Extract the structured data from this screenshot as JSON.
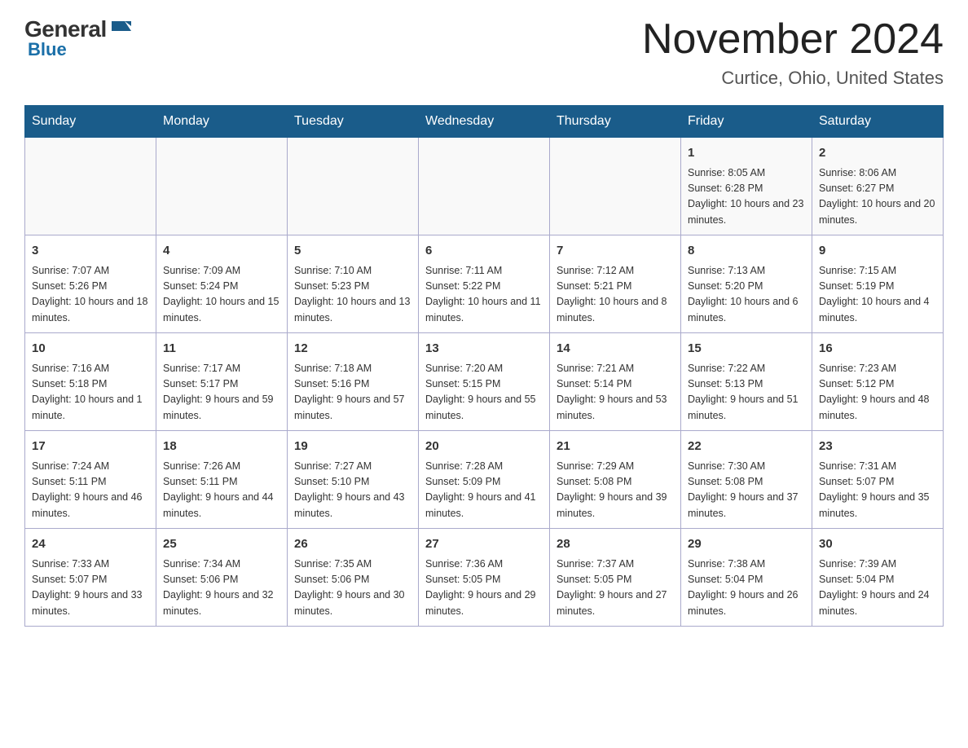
{
  "header": {
    "logo_general": "General",
    "logo_blue": "Blue",
    "month_title": "November 2024",
    "location": "Curtice, Ohio, United States"
  },
  "weekdays": [
    "Sunday",
    "Monday",
    "Tuesday",
    "Wednesday",
    "Thursday",
    "Friday",
    "Saturday"
  ],
  "weeks": [
    [
      {
        "day": "",
        "info": ""
      },
      {
        "day": "",
        "info": ""
      },
      {
        "day": "",
        "info": ""
      },
      {
        "day": "",
        "info": ""
      },
      {
        "day": "",
        "info": ""
      },
      {
        "day": "1",
        "info": "Sunrise: 8:05 AM\nSunset: 6:28 PM\nDaylight: 10 hours and 23 minutes."
      },
      {
        "day": "2",
        "info": "Sunrise: 8:06 AM\nSunset: 6:27 PM\nDaylight: 10 hours and 20 minutes."
      }
    ],
    [
      {
        "day": "3",
        "info": "Sunrise: 7:07 AM\nSunset: 5:26 PM\nDaylight: 10 hours and 18 minutes."
      },
      {
        "day": "4",
        "info": "Sunrise: 7:09 AM\nSunset: 5:24 PM\nDaylight: 10 hours and 15 minutes."
      },
      {
        "day": "5",
        "info": "Sunrise: 7:10 AM\nSunset: 5:23 PM\nDaylight: 10 hours and 13 minutes."
      },
      {
        "day": "6",
        "info": "Sunrise: 7:11 AM\nSunset: 5:22 PM\nDaylight: 10 hours and 11 minutes."
      },
      {
        "day": "7",
        "info": "Sunrise: 7:12 AM\nSunset: 5:21 PM\nDaylight: 10 hours and 8 minutes."
      },
      {
        "day": "8",
        "info": "Sunrise: 7:13 AM\nSunset: 5:20 PM\nDaylight: 10 hours and 6 minutes."
      },
      {
        "day": "9",
        "info": "Sunrise: 7:15 AM\nSunset: 5:19 PM\nDaylight: 10 hours and 4 minutes."
      }
    ],
    [
      {
        "day": "10",
        "info": "Sunrise: 7:16 AM\nSunset: 5:18 PM\nDaylight: 10 hours and 1 minute."
      },
      {
        "day": "11",
        "info": "Sunrise: 7:17 AM\nSunset: 5:17 PM\nDaylight: 9 hours and 59 minutes."
      },
      {
        "day": "12",
        "info": "Sunrise: 7:18 AM\nSunset: 5:16 PM\nDaylight: 9 hours and 57 minutes."
      },
      {
        "day": "13",
        "info": "Sunrise: 7:20 AM\nSunset: 5:15 PM\nDaylight: 9 hours and 55 minutes."
      },
      {
        "day": "14",
        "info": "Sunrise: 7:21 AM\nSunset: 5:14 PM\nDaylight: 9 hours and 53 minutes."
      },
      {
        "day": "15",
        "info": "Sunrise: 7:22 AM\nSunset: 5:13 PM\nDaylight: 9 hours and 51 minutes."
      },
      {
        "day": "16",
        "info": "Sunrise: 7:23 AM\nSunset: 5:12 PM\nDaylight: 9 hours and 48 minutes."
      }
    ],
    [
      {
        "day": "17",
        "info": "Sunrise: 7:24 AM\nSunset: 5:11 PM\nDaylight: 9 hours and 46 minutes."
      },
      {
        "day": "18",
        "info": "Sunrise: 7:26 AM\nSunset: 5:11 PM\nDaylight: 9 hours and 44 minutes."
      },
      {
        "day": "19",
        "info": "Sunrise: 7:27 AM\nSunset: 5:10 PM\nDaylight: 9 hours and 43 minutes."
      },
      {
        "day": "20",
        "info": "Sunrise: 7:28 AM\nSunset: 5:09 PM\nDaylight: 9 hours and 41 minutes."
      },
      {
        "day": "21",
        "info": "Sunrise: 7:29 AM\nSunset: 5:08 PM\nDaylight: 9 hours and 39 minutes."
      },
      {
        "day": "22",
        "info": "Sunrise: 7:30 AM\nSunset: 5:08 PM\nDaylight: 9 hours and 37 minutes."
      },
      {
        "day": "23",
        "info": "Sunrise: 7:31 AM\nSunset: 5:07 PM\nDaylight: 9 hours and 35 minutes."
      }
    ],
    [
      {
        "day": "24",
        "info": "Sunrise: 7:33 AM\nSunset: 5:07 PM\nDaylight: 9 hours and 33 minutes."
      },
      {
        "day": "25",
        "info": "Sunrise: 7:34 AM\nSunset: 5:06 PM\nDaylight: 9 hours and 32 minutes."
      },
      {
        "day": "26",
        "info": "Sunrise: 7:35 AM\nSunset: 5:06 PM\nDaylight: 9 hours and 30 minutes."
      },
      {
        "day": "27",
        "info": "Sunrise: 7:36 AM\nSunset: 5:05 PM\nDaylight: 9 hours and 29 minutes."
      },
      {
        "day": "28",
        "info": "Sunrise: 7:37 AM\nSunset: 5:05 PM\nDaylight: 9 hours and 27 minutes."
      },
      {
        "day": "29",
        "info": "Sunrise: 7:38 AM\nSunset: 5:04 PM\nDaylight: 9 hours and 26 minutes."
      },
      {
        "day": "30",
        "info": "Sunrise: 7:39 AM\nSunset: 5:04 PM\nDaylight: 9 hours and 24 minutes."
      }
    ]
  ]
}
